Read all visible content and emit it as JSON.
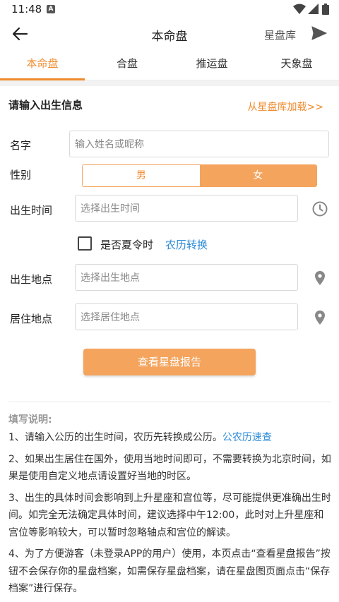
{
  "status": {
    "time": "11:48"
  },
  "header": {
    "title": "本命盘",
    "right_label": "星盘库"
  },
  "tabs": [
    "本命盘",
    "合盘",
    "推运盘",
    "天象盘"
  ],
  "form": {
    "section_title": "请输入出生信息",
    "load_link": "从星盘库加载>>",
    "name_label": "名字",
    "name_placeholder": "输入姓名或昵称",
    "gender_label": "性别",
    "gender_male": "男",
    "gender_female": "女",
    "time_label": "出生时间",
    "time_placeholder": "选择出生时间",
    "dst_label": "是否夏令时",
    "lunar_link": "农历转换",
    "birthplace_label": "出生地点",
    "birthplace_placeholder": "选择出生地点",
    "residence_label": "居住地点",
    "residence_placeholder": "选择居住地点",
    "submit": "查看星盘报告"
  },
  "notes": {
    "title": "填写说明:",
    "n1": "1、请输入公历的出生时间，农历先转换成公历。",
    "n1_link": "公农历速查",
    "n2": "2、如果出生居住在国外，使用当地时间即可，不需要转换为北京时间，如果是使用自定义地点请设置好当地的时区。",
    "n3": "3、出生的具体时间会影响到上升星座和宫位等，尽可能提供更准确出生时间。如完全无法确定具体时间，建议选择中午12:00，此时对上升星座和宫位等影响较大，可以暂时忽略轴点和宫位的解读。",
    "n4": "4、为了方便游客（未登录APP的用户）使用，本页点击“查看星盘报告”按钮不会保存你的星盘档案，如需保存星盘档案，请在星盘图页面点击“保存档案”进行保存。"
  },
  "colors": {
    "accent": "#f08a2b",
    "accent_light": "#f4a45d",
    "link": "#2a8ad8"
  }
}
